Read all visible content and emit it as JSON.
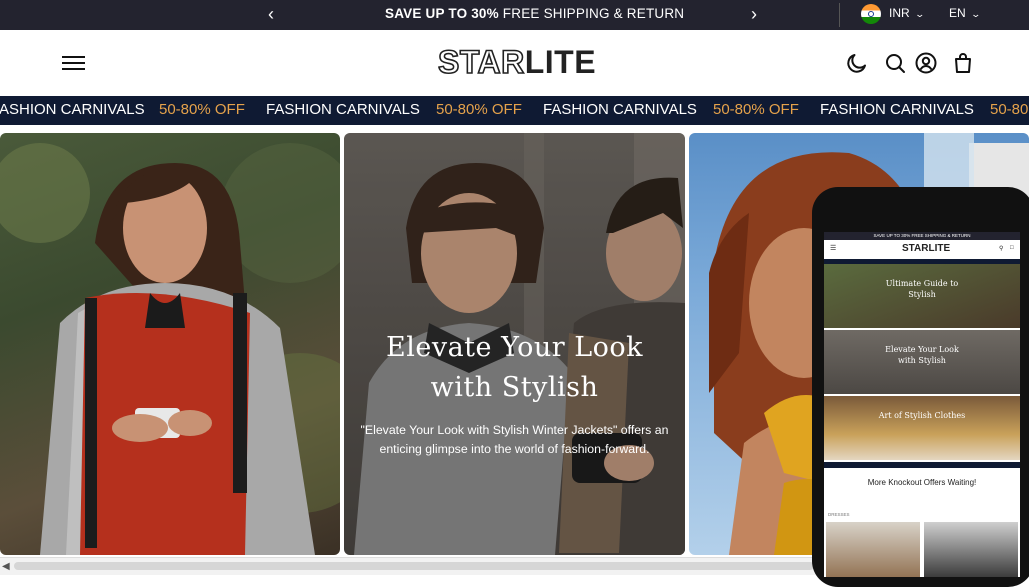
{
  "announcement": {
    "bold": "SAVE UP TO 30%",
    "rest": " FREE SHIPPING & RETURN",
    "prev_icon": "chevron-left-icon",
    "next_icon": "chevron-right-icon",
    "currency": "INR",
    "language": "EN"
  },
  "header": {
    "logo_part1": "STAR",
    "logo_part2": "LITE",
    "icons": [
      "menu-icon",
      "moon-icon",
      "search-icon",
      "user-icon",
      "bag-icon"
    ]
  },
  "marquee": {
    "items": [
      {
        "text": "ASHION CARNIVALS",
        "accent": false
      },
      {
        "text": "50-80% OFF",
        "accent": true
      },
      {
        "text": "FASHION CARNIVALS",
        "accent": false
      },
      {
        "text": "50-80% OFF",
        "accent": true
      },
      {
        "text": "FASHION CARNIVALS",
        "accent": false
      },
      {
        "text": "50-80% OFF",
        "accent": true
      },
      {
        "text": "FASHION CARNIVALS",
        "accent": false
      },
      {
        "text": "50-80",
        "accent": true
      }
    ]
  },
  "hero": {
    "title_line1": "Elevate Your Look",
    "title_line2": "with Stylish",
    "subtitle_line1": "\"Elevate Your Look with Stylish Winter Jackets\" offers an",
    "subtitle_line2": "enticing glimpse into the world of fashion-forward."
  },
  "mobile": {
    "announce": "SAVE UP TO 30% FREE SHIPPING & RETURN",
    "logo": "STARLITE",
    "cards": [
      {
        "title_line1": "Ultimate Guide to",
        "title_line2": "Stylish"
      },
      {
        "title_line1": "Elevate Your Look",
        "title_line2": "with Stylish"
      },
      {
        "title_line1": "Art of Stylish Clothes",
        "title_line2": ""
      }
    ],
    "offer_title": "More Knockout Offers Waiting!",
    "tab_dresses": "DRESSES"
  },
  "colors": {
    "dark_bar": "#23232f",
    "marquee_bg": "#0f1a33",
    "accent_orange": "#e5a24b"
  }
}
